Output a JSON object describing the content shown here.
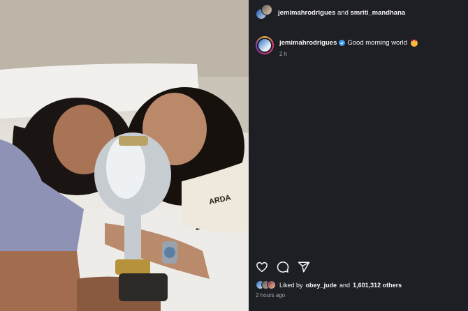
{
  "post": {
    "photo_alt": "Two women lying on a pillow holding a silver trophy",
    "authors": {
      "user1": "jemimahrodrigues",
      "joiner": "and",
      "user2": "smriti_mandhana"
    },
    "caption": {
      "username": "jemimahrodrigues",
      "text": "Good morning world",
      "time": "2 h"
    },
    "likes": {
      "prefix": "Liked by",
      "user": "obey_jude",
      "joiner": "and",
      "count": "1,601,312 others"
    },
    "posted_ago": "2 hours ago"
  },
  "icons": [
    "heart-icon",
    "comment-icon",
    "share-icon",
    "verified-badge-icon"
  ],
  "colors": {
    "panel_bg": "#1e1f24",
    "verified": "#3897f0",
    "muted": "#a8a8a8"
  }
}
